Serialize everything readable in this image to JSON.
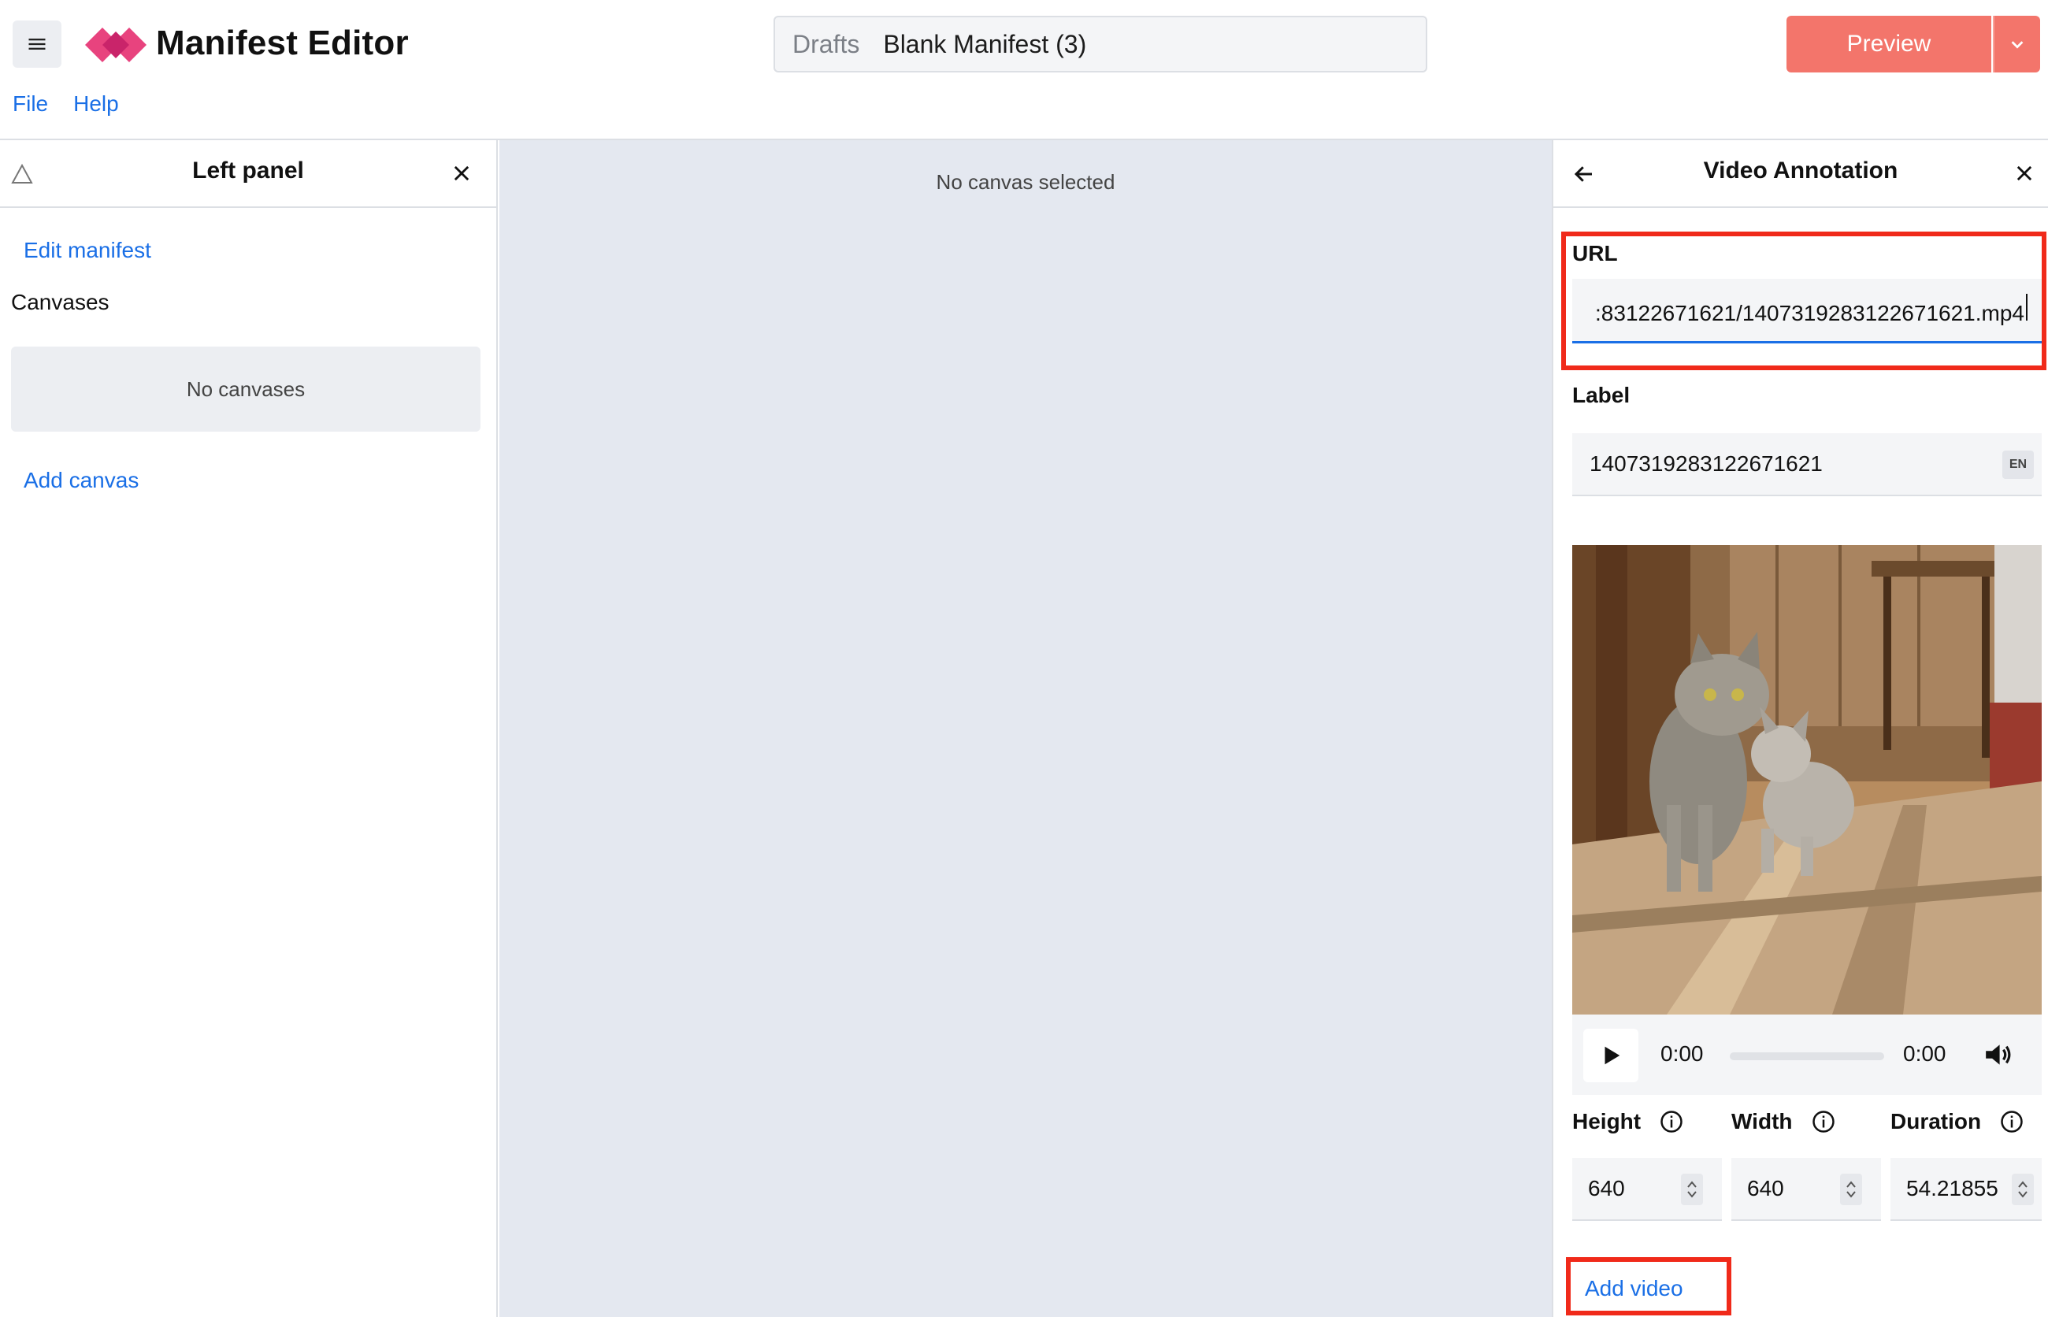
{
  "header": {
    "app_title": "Manifest Editor",
    "menu": [
      "File",
      "Help"
    ],
    "folder": "Drafts",
    "document_name": "Blank Manifest (3)",
    "preview_label": "Preview"
  },
  "left_panel": {
    "title": "Left panel",
    "edit_manifest": "Edit manifest",
    "canvases_heading": "Canvases",
    "empty_message": "No canvases",
    "add_canvas": "Add canvas"
  },
  "center": {
    "message": "No canvas selected"
  },
  "right_panel": {
    "title": "Video Annotation",
    "url_label": "URL",
    "url_value": ":83122671621/1407319283122671621.mp4",
    "label_label": "Label",
    "label_value": "1407319283122671621",
    "label_lang": "EN",
    "player": {
      "current_time": "0:00",
      "duration": "0:00",
      "progress": 0.0
    },
    "height_label": "Height",
    "height_value": "640",
    "width_label": "Width",
    "width_value": "640",
    "duration_label": "Duration",
    "duration_value": "54.21855",
    "add_video": "Add video"
  },
  "colors": {
    "accent": "#1a6fe6",
    "preview": "#f3756b",
    "highlight": "#f02a1a",
    "canvas_bg": "#e4e8f0",
    "logo": "#e8437e"
  },
  "icons": [
    "menu-icon",
    "logo-icon",
    "chevron-down-icon",
    "warning-triangle-icon",
    "close-icon",
    "back-arrow-icon",
    "play-icon",
    "volume-icon",
    "info-icon",
    "spinner-arrows-icon"
  ]
}
